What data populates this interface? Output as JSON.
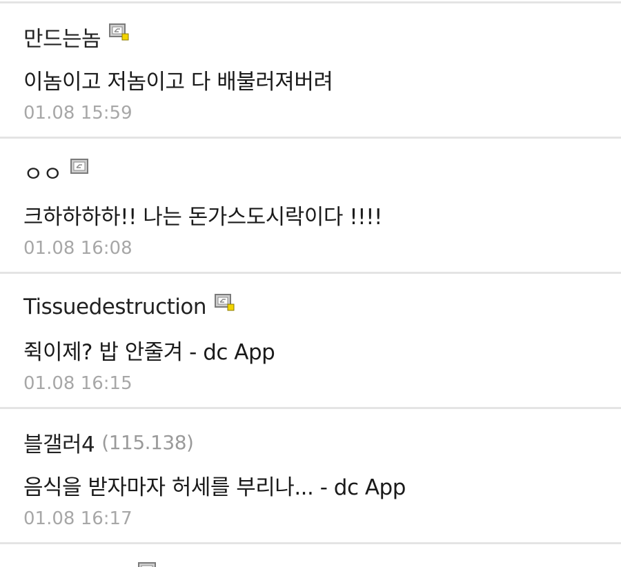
{
  "comments": [
    {
      "nickname": "만드는놈",
      "ip": "",
      "icon": "gallog-icon-fixed",
      "text": "이놈이고 저놈이고 다 배불러져버려",
      "date": "01.08 15:59"
    },
    {
      "nickname": "ㅇㅇ",
      "ip": "",
      "icon": "gallog-icon",
      "text": "크하하하하!! 나는 돈가스도시락이다 !!!!",
      "date": "01.08 16:08"
    },
    {
      "nickname": "Tissuedestruction",
      "ip": "",
      "icon": "gallog-icon-fixed",
      "text": "쥑이제? 밥 안줄겨 - dc App",
      "date": "01.08 16:15"
    },
    {
      "nickname": "블갤러4",
      "ip": "(115.138)",
      "icon": "",
      "text": "음식을 받자마자 허세를 부리나... - dc App",
      "date": "01.08 16:17"
    }
  ],
  "colors": {
    "divider": "#e4e4e4",
    "text": "#1a1a1a",
    "meta": "#a7a7a7",
    "icon_badge": "#f2d400"
  }
}
